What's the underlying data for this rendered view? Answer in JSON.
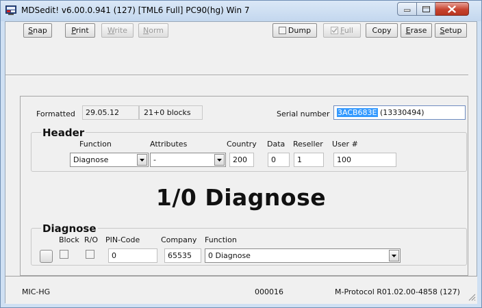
{
  "window": {
    "title": "MDSedit! v6.00.0.941 (127) [TML6 Full] PC90(hg) Win 7",
    "controls": [
      "minimize",
      "maximize",
      "close"
    ]
  },
  "toolbar": {
    "snap": {
      "pre": "",
      "u": "S",
      "post": "nap"
    },
    "print": {
      "pre": "",
      "u": "P",
      "post": "rint"
    },
    "write": {
      "pre": "",
      "u": "W",
      "post": "rite"
    },
    "norm": {
      "pre": "",
      "u": "N",
      "post": "orm"
    },
    "dump": {
      "pre": "",
      "u": "",
      "post": "Dump"
    },
    "full": {
      "pre": "",
      "u": "F",
      "post": "ull"
    },
    "copy": {
      "pre": "",
      "u": "",
      "post": "Copy"
    },
    "erase": {
      "pre": "",
      "u": "E",
      "post": "rase"
    },
    "setup": {
      "pre": "",
      "u": "S",
      "post": "etup"
    }
  },
  "info": {
    "formatted_label": "Formatted",
    "formatted_date": "29.05.12",
    "blocks": "21+0 blocks",
    "serial_label": "Serial number",
    "serial_selected": "3ACB683E",
    "serial_rest": " (13330494)"
  },
  "header": {
    "title": "Header",
    "function_label": "Function",
    "function_value": "Diagnose",
    "attributes_label": "Attributes",
    "attributes_value": "-",
    "country_label": "Country",
    "country_value": "200",
    "data_label": "Data",
    "data_value": "0",
    "reseller_label": "Reseller",
    "reseller_value": "1",
    "user_label": "User #",
    "user_value": "100"
  },
  "main_display": "1/0 Diagnose",
  "diagnose": {
    "title": "Diagnose",
    "block_label": "Block",
    "ro_label": "R/O",
    "pin_label": "PIN-Code",
    "pin_value": "0",
    "company_label": "Company",
    "company_value": "65535",
    "function_label": "Function",
    "function_value": "0 Diagnose"
  },
  "status": {
    "left": "MIC-HG",
    "center": "000016",
    "right": "M-Protocol R01.02.00-4858 (127)"
  },
  "colors": {
    "selection": "#3399ff",
    "close_button": "#c7432f",
    "title_bar": "#c3d7ee"
  }
}
